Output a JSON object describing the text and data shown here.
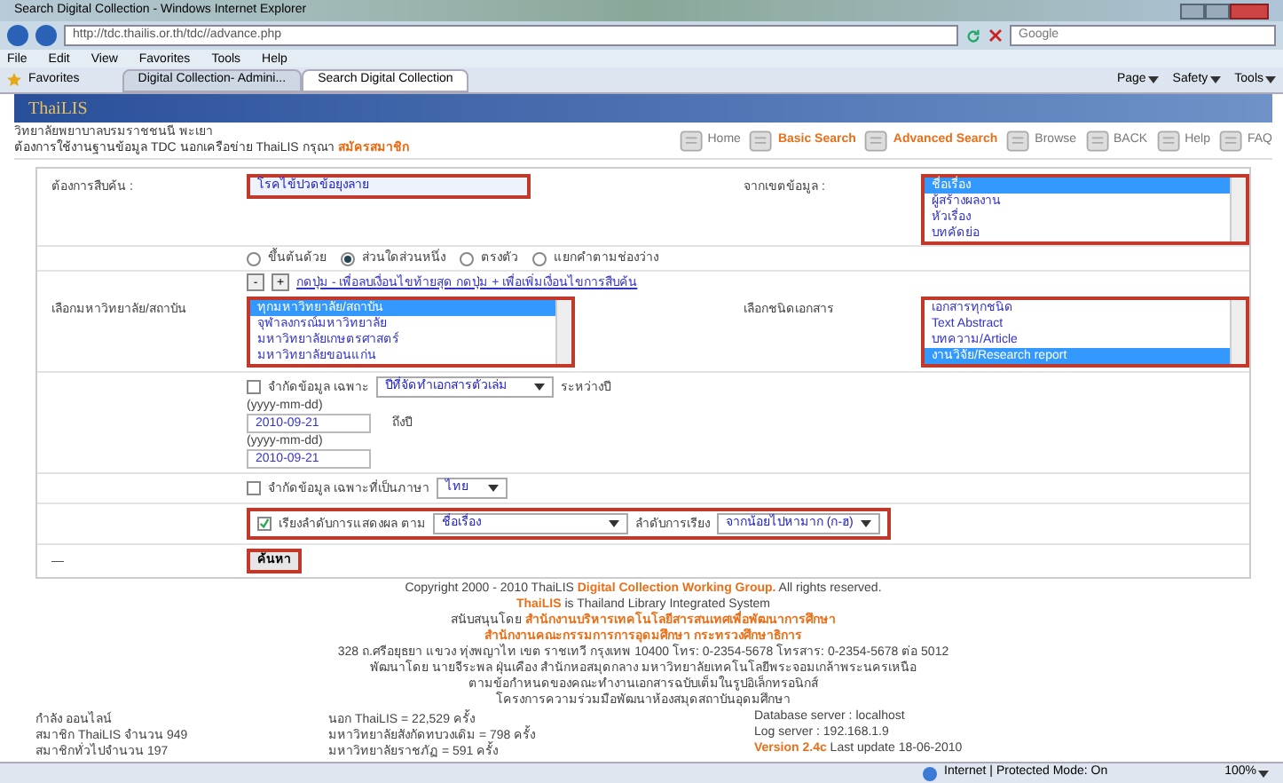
{
  "browser": {
    "title": "Search Digital Collection - Windows Internet Explorer",
    "address": "http://tdc.thailis.or.th/tdc//advance.php",
    "search_placeholder": "Google",
    "menu": [
      "File",
      "Edit",
      "View",
      "Favorites",
      "Tools",
      "Help"
    ],
    "favorites": "Favorites",
    "tabs": [
      {
        "label": "Digital Collection- Admini...",
        "selected": false
      },
      {
        "label": "Search Digital Collection",
        "selected": true
      }
    ],
    "toolbar": [
      "Page",
      "Safety",
      "Tools"
    ]
  },
  "site": {
    "logo": "ThaiLIS",
    "org": "วิทยาลัยพยาบาลบรมราชชนนี พะเยา",
    "notice": "ต้องการใช้งานฐานข้อมูล TDC นอกเครือข่าย ThaiLIS กรุณา",
    "signup_link": "สมัครสมาชิก",
    "nav": [
      {
        "label": "Home",
        "highlighted": false
      },
      {
        "label": "Basic Search",
        "highlighted": true
      },
      {
        "label": "Advanced Search",
        "highlighted": true
      },
      {
        "label": "Browse",
        "highlighted": false
      },
      {
        "label": "BACK",
        "highlighted": false
      },
      {
        "label": "Help",
        "highlighted": false
      },
      {
        "label": "FAQ",
        "highlighted": false
      }
    ]
  },
  "form": {
    "query": {
      "label": "ต้องการสืบค้น :",
      "value": "โรคไข้ปวดข้อยุงลาย",
      "annotated": true
    },
    "field": {
      "label": "จากเขตข้อมูล :",
      "annotated": true,
      "options": [
        {
          "label": "ชื่อเรื่อง",
          "selected": true
        },
        {
          "label": "ผู้สร้างผลงาน",
          "selected": false
        },
        {
          "label": "หัวเรื่อง",
          "selected": false
        },
        {
          "label": "บทคัดย่อ",
          "selected": false
        }
      ]
    },
    "match": [
      {
        "label": "ขึ้นต้นด้วย",
        "selected": false
      },
      {
        "label": "ส่วนใดส่วนหนึ่ง",
        "selected": true
      },
      {
        "label": "ตรงตัว",
        "selected": false
      },
      {
        "label": "แยกคำตามช่องว่าง",
        "selected": false
      }
    ],
    "condition_buttons": [
      "-",
      "+"
    ],
    "condition_hint": "กดปุ่ม - เพื่อลบเงื่อนไขท้ายสุด กดปุ่ม + เพื่อเพิ่มเงื่อนไขการสืบค้น",
    "institution": {
      "label": "เลือกมหาวิทยาลัย/สถาบัน",
      "annotated": true,
      "options": [
        {
          "label": "ทุกมหาวิทยาลัย/สถาบัน",
          "selected": true
        },
        {
          "label": "จุฬาลงกรณ์มหาวิทยาลัย",
          "selected": false
        },
        {
          "label": "มหาวิทยาลัยเกษตรศาสตร์",
          "selected": false
        },
        {
          "label": "มหาวิทยาลัยขอนแก่น",
          "selected": false
        }
      ]
    },
    "doctype": {
      "label": "เลือกชนิดเอกสาร",
      "annotated": true,
      "options": [
        {
          "label": "เอกสารทุกชนิด",
          "selected": false
        },
        {
          "label": "Text Abstract",
          "selected": false
        },
        {
          "label": "บทความ/Article",
          "selected": false
        },
        {
          "label": "งานวิจัย/Research report",
          "selected": true
        }
      ]
    },
    "year_limit": {
      "checked": false,
      "label": "จำกัดข้อมูล เฉพาะ",
      "select": "ปีที่จัดทำเอกสารตัวเล่ม",
      "between": "ระหว่างปี",
      "from_hint": "(yyyy-mm-dd)",
      "from": "2010-09-21",
      "to_label": "ถึงปี",
      "to_hint": "(yyyy-mm-dd)",
      "to": "2010-09-21"
    },
    "language_limit": {
      "checked": false,
      "label": "จำกัดข้อมูล เฉพาะที่เป็นภาษา",
      "select": "ไทย"
    },
    "sort": {
      "checked": true,
      "annotated": true,
      "label": "เรียงลำดับการแสดงผล ตาม",
      "select": "ชื่อเรื่อง",
      "order_label": "ลำดับการเรียง",
      "order": "จากน้อยไปหามาก (ก-ฮ)"
    },
    "dash": "—",
    "submit": {
      "label": "ค้นหา",
      "annotated": true
    }
  },
  "footer": [
    {
      "text": "Copyright 2000 - 2010 ThaiLIS **Digital Collection Working Group.** All rights reserved.",
      "accent": false
    },
    {
      "text": "**ThaiLIS** is Thailand Library Integrated System",
      "accent": false
    },
    {
      "text": "สนับสนุนโดย **สำนักงานบริหารเทคโนโลยีสารสนเทศเพื่อพัฒนาการศึกษา**",
      "accent": false
    },
    {
      "text": "สำนักงานคณะกรรมการการอุดมศึกษา กระทรวงศึกษาธิการ",
      "accent": true
    },
    {
      "text": "328 ถ.ศรีอยุธยา แขวง ทุ่งพญาไท เขต ราชเทวี กรุงเทพ 10400 โทร: 0-2354-5678 โทรสาร: 0-2354-5678 ต่อ 5012",
      "accent": false
    },
    {
      "text": "พัฒนาโดย นายจีระพล ฝุ่นเคือง สำนักหอสมุดกลาง มหาวิทยาลัยเทคโนโลยีพระจอมเกล้าพระนครเหนือ",
      "accent": false
    },
    {
      "text": "ตามข้อกำหนดของคณะทำงานเอกสารฉบับเต็มในรูปอิเล็กทรอนิกส์",
      "accent": false
    },
    {
      "text": "โครงการความร่วมมือพัฒนาห้องสมุดสถาบันอุดมศึกษา",
      "accent": false
    }
  ],
  "stats": {
    "online": [
      "กำลัง ออนไลน์",
      "สมาชิก ThaiLIS จำนวน 949",
      "สมาชิกทั่วไปจำนวน 197"
    ],
    "visits": [
      "นอก ThaiLIS = 22,529 ครั้ง",
      "มหาวิทยาลัยสังกัดทบวงเดิม = 798 ครั้ง",
      "มหาวิทยาลัยราชภัฏ = 591 ครั้ง"
    ],
    "server": [
      "Database server : localhost",
      "Log server : 192.168.1.9"
    ],
    "version": "**Version 2.4c** Last update 18-06-2010"
  },
  "status_bar": {
    "zone": "Internet | Protected Mode: On",
    "zoom": "100%"
  }
}
